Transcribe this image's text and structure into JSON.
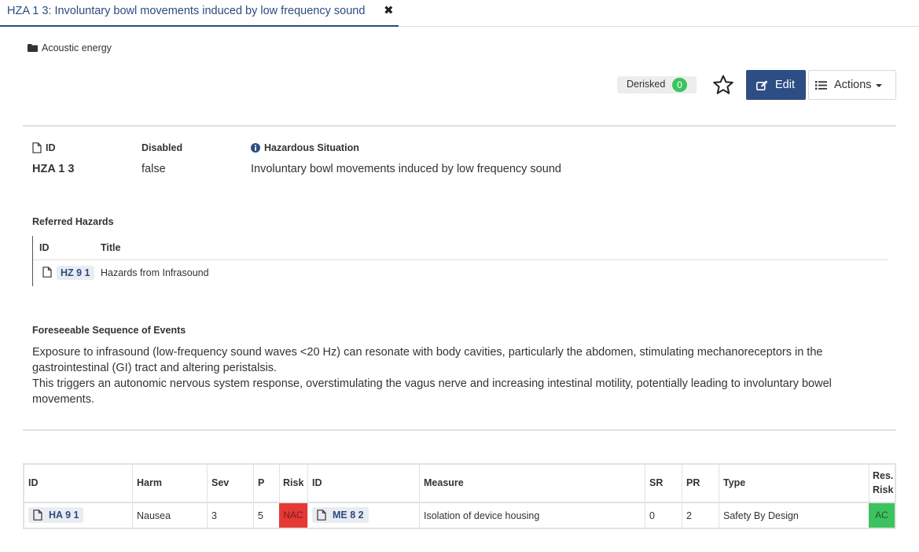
{
  "tab": {
    "title": "HZA 1 3: Involuntary bowl movements induced by low frequency sound",
    "close_icon": "close-icon"
  },
  "breadcrumb": {
    "icon": "folder-icon",
    "label": "Acoustic energy"
  },
  "toolbar": {
    "derisked_label": "Derisked",
    "derisked_count": "0",
    "star_icon": "star-icon",
    "edit_label": "Edit",
    "actions_label": "Actions",
    "accent_color": "#2d4e85"
  },
  "fields": {
    "id_label": "ID",
    "id_value": "HZA 1 3",
    "disabled_label": "Disabled",
    "disabled_value": "false",
    "situation_label": "Hazardous Situation",
    "situation_value": "Involuntary bowl movements induced by low frequency sound"
  },
  "referred_hazards": {
    "heading": "Referred Hazards",
    "columns": [
      "ID",
      "Title"
    ],
    "rows": [
      {
        "id": "HZ 9 1",
        "title": "Hazards from Infrasound"
      }
    ]
  },
  "sequence": {
    "heading": "Foreseeable Sequence of Events",
    "line1": "Exposure to infrasound (low-frequency sound waves <20 Hz) can resonate with body cavities, particularly the abdomen, stimulating mechanoreceptors in the gastrointestinal (GI) tract and altering peristalsis.",
    "line2": "This triggers an autonomic nervous system response, overstimulating the vagus nerve and increasing intestinal motility, potentially leading to involuntary bowel movements."
  },
  "risk_table": {
    "headers": [
      "ID",
      "Harm",
      "Sev",
      "P",
      "Risk",
      "ID",
      "Measure",
      "SR",
      "PR",
      "Type",
      "Res.",
      "Risk"
    ],
    "row": {
      "harm_id": "HA 9 1",
      "harm": "Nausea",
      "sev": "3",
      "p": "5",
      "risk": "NAC",
      "measure_id": "ME 8 2",
      "measure": "Isolation of device housing",
      "sr": "0",
      "pr": "2",
      "type": "Safety By Design",
      "res_risk": "AC"
    },
    "colors": {
      "risk_bad": "#e53935",
      "risk_ok": "#3cc35f"
    }
  }
}
